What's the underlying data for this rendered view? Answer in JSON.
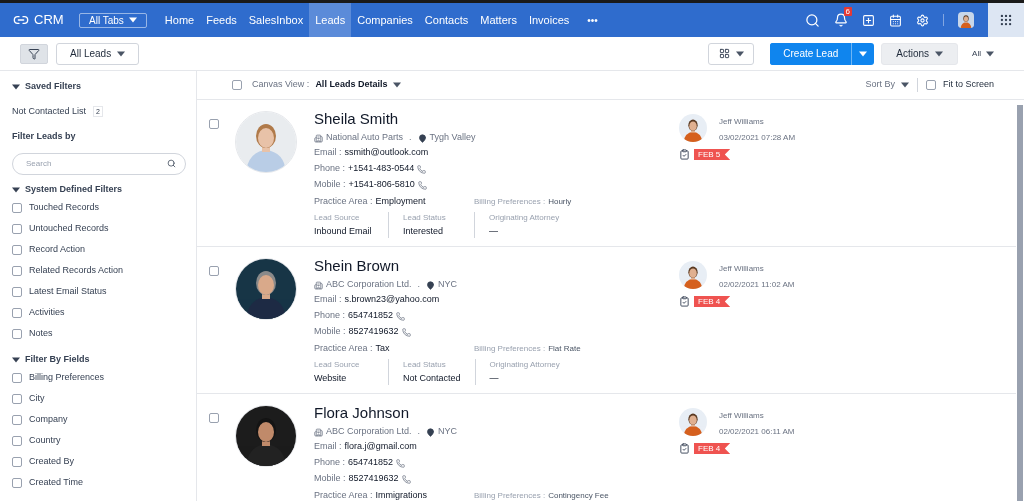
{
  "nav": {
    "brand": "CRM",
    "all_tabs": "All Tabs",
    "more": "•••",
    "notification_count": "6",
    "tabs": [
      {
        "label": "Home",
        "selected": false
      },
      {
        "label": "Feeds",
        "selected": false
      },
      {
        "label": "SalesInbox",
        "selected": false
      },
      {
        "label": "Leads",
        "selected": true
      },
      {
        "label": "Companies",
        "selected": false
      },
      {
        "label": "Contacts",
        "selected": false
      },
      {
        "label": "Matters",
        "selected": false
      },
      {
        "label": "Invoices",
        "selected": false
      }
    ]
  },
  "toolbar": {
    "view_filter": "All Leads",
    "create": "Create Lead",
    "actions": "Actions",
    "scope": "All"
  },
  "sidebar": {
    "saved_title": "Saved Filters",
    "saved": [
      {
        "label": "Not Contacted List",
        "count": "2"
      }
    ],
    "filter_title": "Filter Leads by",
    "search_placeholder": "Search",
    "groups": [
      {
        "title": "System Defined Filters",
        "expanded": true,
        "items": [
          {
            "label": "Touched Records",
            "checked": false
          },
          {
            "label": "Untouched Records",
            "checked": false
          },
          {
            "label": "Record Action",
            "checked": false
          },
          {
            "label": "Related Records Action",
            "checked": false
          },
          {
            "label": "Latest Email Status",
            "checked": false
          },
          {
            "label": "Activities",
            "checked": false
          },
          {
            "label": "Notes",
            "checked": false
          }
        ]
      },
      {
        "title": "Filter By Fields",
        "expanded": true,
        "items": [
          {
            "label": "Billing Preferences",
            "checked": false
          },
          {
            "label": "City",
            "checked": false
          },
          {
            "label": "Company",
            "checked": false
          },
          {
            "label": "Country",
            "checked": false
          },
          {
            "label": "Created By",
            "checked": false
          },
          {
            "label": "Created Time",
            "checked": false
          }
        ]
      }
    ]
  },
  "list_header": {
    "select_all_checked": false,
    "canvas_label": "Canvas View :",
    "canvas_value": "All Leads Details",
    "sort": "Sort By",
    "fit": "Fit to Screen",
    "fit_checked": false
  },
  "leads": [
    {
      "checked": false,
      "name": "Sheila Smith",
      "company": "National Auto Parts",
      "sep": ".",
      "city": "Tygh Valley",
      "contacts": [
        {
          "label": "Email :",
          "value": "ssmith@outlook.com",
          "kind": "email"
        },
        {
          "label": "Phone :",
          "value": "+1541-483-0544",
          "kind": "phone"
        },
        {
          "label": "Mobile :",
          "value": "+1541-806-5810",
          "kind": "phone"
        }
      ],
      "practice": {
        "label": "Practice Area :",
        "value": "Employment"
      },
      "billing": {
        "label": "Billing Preferences :",
        "value": "Hourly"
      },
      "stats": [
        {
          "label": "Lead Source",
          "value": "Inbound Email"
        },
        {
          "label": "Lead Status",
          "value": "Interested"
        },
        {
          "label": "Originating Attorney",
          "value": "—"
        }
      ],
      "owner": "Jeff Williams",
      "time": "03/02/2021 07:28 AM",
      "due": "FEB 5"
    },
    {
      "checked": false,
      "name": "Shein Brown",
      "company": "ABC Corporation Ltd.",
      "sep": ".",
      "city": "NYC",
      "contacts": [
        {
          "label": "Email :",
          "value": "s.brown23@yahoo.com",
          "kind": "email"
        },
        {
          "label": "Phone :",
          "value": "654741852",
          "kind": "phone"
        },
        {
          "label": "Mobile :",
          "value": "8527419632",
          "kind": "phone"
        }
      ],
      "practice": {
        "label": "Practice Area :",
        "value": "Tax"
      },
      "billing": {
        "label": "Billing Preferences :",
        "value": "Flat Rate"
      },
      "stats": [
        {
          "label": "Lead Source",
          "value": "Website"
        },
        {
          "label": "Lead Status",
          "value": "Not Contacted"
        },
        {
          "label": "Originating Attorney",
          "value": "—"
        }
      ],
      "owner": "Jeff Williams",
      "time": "02/02/2021 11:02 AM",
      "due": "FEB 4"
    },
    {
      "checked": false,
      "name": "Flora Johnson",
      "company": "ABC Corporation Ltd.",
      "sep": ".",
      "city": "NYC",
      "contacts": [
        {
          "label": "Email :",
          "value": "flora.j@gmail.com",
          "kind": "email"
        },
        {
          "label": "Phone :",
          "value": "654741852",
          "kind": "phone"
        },
        {
          "label": "Mobile :",
          "value": "8527419632",
          "kind": "phone"
        }
      ],
      "practice": {
        "label": "Practice Area :",
        "value": "Immigrations"
      },
      "billing": {
        "label": "Billing Preferences :",
        "value": "Contingency Fee"
      },
      "owner": "Jeff Williams",
      "time": "02/02/2021 06:11 AM",
      "due": "FEB 4"
    }
  ]
}
